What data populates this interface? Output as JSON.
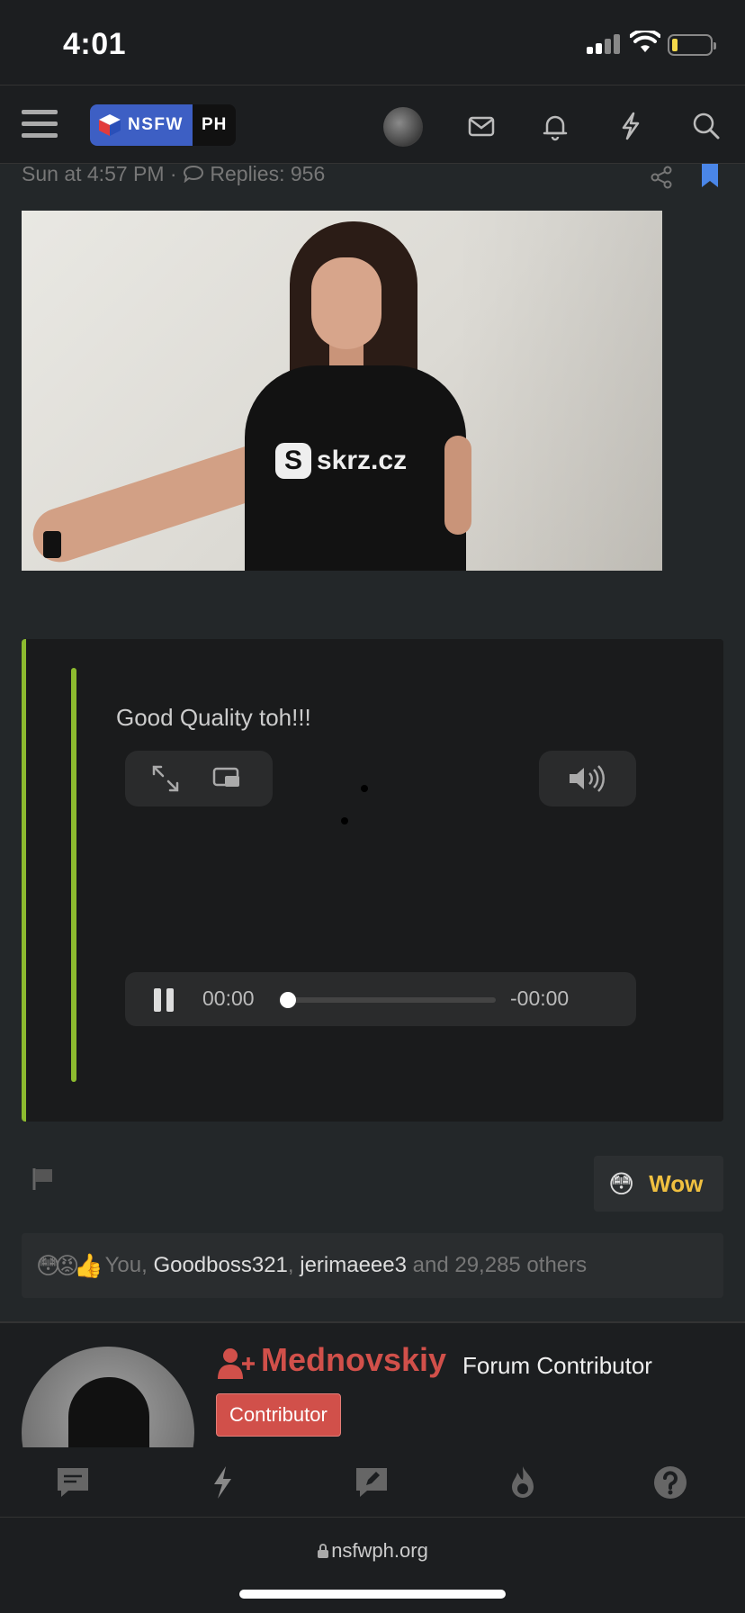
{
  "status_bar": {
    "time": "4:01"
  },
  "header": {
    "logo_left": "NSFW",
    "logo_right": "PH",
    "icons": [
      "menu-icon",
      "avatar",
      "mail-icon",
      "bell-icon",
      "bolt-icon",
      "search-icon"
    ]
  },
  "post": {
    "meta_date": "Sun at 4:57 PM ·",
    "replies": "Replies: 956",
    "image_shirt_text": "skrz.cz",
    "image_shirt_letter": "S"
  },
  "quote": {
    "text": "Good Quality toh!!!",
    "player": {
      "current_time": "00:00",
      "remaining_time": "-00:00",
      "progress": 0
    }
  },
  "actions": {
    "reaction_emoji": "😳",
    "reaction_label": "Wow"
  },
  "reactions": {
    "emojis": "😳😡👍",
    "prefix": "You,",
    "user1": "Goodboss321",
    "sep": ",",
    "user2": "jerimaeee3",
    "suffix": "and 29,285 others"
  },
  "author": {
    "name": "Mednovskiy",
    "title": "Forum Contributor",
    "badge": "Contributor"
  },
  "tabbar": {
    "icons": [
      "chat-icon",
      "bolt-icon",
      "edit-icon",
      "fire-icon",
      "help-icon"
    ]
  },
  "url_bar": {
    "url": "nsfwph.org"
  },
  "colors": {
    "accent_green": "#8dbb2f",
    "author_red": "#d1504a",
    "wow_gold": "#f0c040",
    "logo_blue": "#3d5fc4"
  }
}
